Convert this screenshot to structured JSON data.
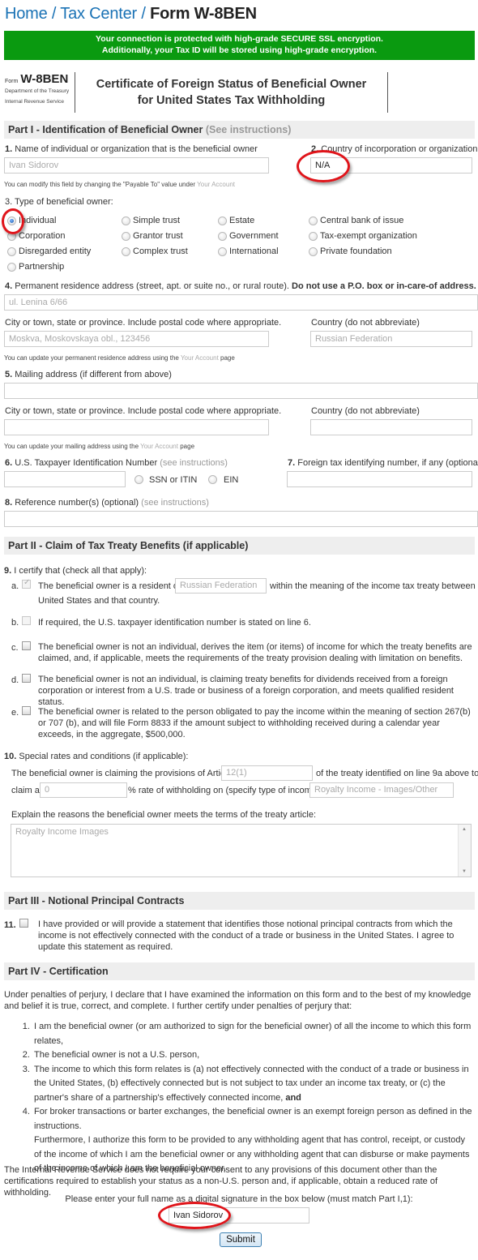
{
  "breadcrumb": {
    "home": "Home",
    "tax_center": "Tax Center",
    "current": "Form W-8BEN",
    "separator": "/"
  },
  "ssl_banner": {
    "line1": "Your connection is protected with high-grade SECURE SSL encryption.",
    "line2": "Additionally, your Tax ID will be stored using high-grade encryption.",
    "color": "#0a9a10"
  },
  "form_header": {
    "form_word": "Form",
    "form_name": "W-8BEN",
    "dept1": "Department of the Treasury",
    "dept2": "Internal Revenue Service",
    "title1": "Certificate of Foreign Status of Beneficial Owner",
    "title2": "for United States Tax Withholding"
  },
  "part1": {
    "title": "Part I - Identification of Beneficial Owner",
    "see": "(See instructions)",
    "q1_num": "1.",
    "q1_label": "Name of individual or organization that is the beneficial owner",
    "q1_value": "Ivan Sidorov",
    "q1_note_pre": "You can modify this field by changing the \"Payable To\" value under",
    "q1_note_link": "Your Account",
    "q2_num": "2.",
    "q2_label": "Country of incorporation or organization",
    "q2_value": "N/A",
    "q3_num": "3.",
    "q3_label": "Type of beneficial owner:",
    "owner_types": [
      {
        "label": "Individual",
        "checked": true
      },
      {
        "label": "Simple trust",
        "checked": false
      },
      {
        "label": "Estate",
        "checked": false
      },
      {
        "label": "Central bank of issue",
        "checked": false
      },
      {
        "label": "Corporation",
        "checked": false
      },
      {
        "label": "Grantor trust",
        "checked": false
      },
      {
        "label": "Government",
        "checked": false
      },
      {
        "label": "Tax-exempt organization",
        "checked": false
      },
      {
        "label": "Disregarded entity",
        "checked": false
      },
      {
        "label": "Complex trust",
        "checked": false
      },
      {
        "label": "International",
        "checked": false
      },
      {
        "label": "Private foundation",
        "checked": false
      },
      {
        "label": "Partnership",
        "checked": false
      }
    ],
    "q4_num": "4.",
    "q4_label": "Permanent residence address (street, apt. or suite no., or rural route).",
    "q4_bold": "Do not use a P.O. box or in-care-of address.",
    "q4_value": "ul. Lenina 6/66",
    "city_label": "City or town, state or province. Include postal code where appropriate.",
    "city_value": "Moskva, Moskovskaya obl., 123456",
    "country_label": "Country (do not abbreviate)",
    "country_value": "Russian Federation",
    "q4_note_pre": "You can update your permanent residence address using the",
    "q4_note_link": "Your Account",
    "q4_note_post": "page",
    "q5_num": "5.",
    "q5_label": "Mailing address (if different from above)",
    "q5_value": "",
    "mail_city_label": "City or town, state or province. Include postal code where appropriate.",
    "mail_city_value": "",
    "mail_country_label": "Country (do not abbreviate)",
    "mail_country_value": "",
    "q5_note_pre": "You can update your mailing address using the",
    "q5_note_link": "Your Account",
    "q5_note_post": "page",
    "q6_num": "6.",
    "q6_label": "U.S. Taxpayer Identification Number",
    "q6_see": "(see instructions)",
    "q6_value": "",
    "tin_types": [
      {
        "label": "SSN or ITIN",
        "checked": false
      },
      {
        "label": "EIN",
        "checked": false
      }
    ],
    "q7_num": "7.",
    "q7_label": "Foreign tax identifying number, if any (optional)",
    "q7_value": "",
    "q8_num": "8.",
    "q8_label": "Reference number(s) (optional)",
    "q8_see": "(see instructions)",
    "q8_value": ""
  },
  "part2": {
    "title": "Part II - Claim of Tax Treaty Benefits (if applicable)",
    "q9_num": "9.",
    "q9_label": "I certify that (check all that apply):",
    "items": [
      {
        "letter": "a.",
        "checked": true,
        "disabled": true,
        "text_pre": "The beneficial owner is a resident of",
        "input": "Russian Federation",
        "text_post": "within the meaning of the income tax treaty between the",
        "text_line2": "United States and that country."
      },
      {
        "letter": "b.",
        "checked": false,
        "disabled": true,
        "text": "If required, the U.S. taxpayer identification number is stated on line 6."
      },
      {
        "letter": "c.",
        "checked": false,
        "disabled": false,
        "text": "The beneficial owner is not an individual, derives the item (or items) of income for which the treaty benefits are claimed, and, if applicable, meets the requirements of the treaty provision dealing with limitation on benefits."
      },
      {
        "letter": "d.",
        "checked": false,
        "disabled": false,
        "text": "The beneficial owner is not an individual, is claiming treaty benefits for dividends received from a foreign corporation or interest from a U.S. trade or business of a foreign corporation, and meets qualified resident status."
      },
      {
        "letter": "e.",
        "checked": false,
        "disabled": false,
        "text": "The beneficial owner is related to the person obligated to pay the income within the meaning of section 267(b) or 707 (b), and will file Form 8833 if the amount subject to withholding received during a calendar year exceeds, in the aggregate, $500,000."
      }
    ],
    "q10_num": "10.",
    "q10_label": "Special rates and conditions (if applicable):",
    "q10_text1": "The beneficial owner is claiming the provisions of Article",
    "article_value": "12(1)",
    "q10_text2": "of the treaty identified on line 9a above to",
    "q10_text3": "claim a",
    "rate_value": "0",
    "q10_text4": "% rate of withholding on (specify type of income):",
    "income_type_value": "Royalty Income - Images/Other",
    "explain_label": "Explain the reasons the beneficial owner meets the terms of the treaty article:",
    "explain_value": "Royalty Income Images"
  },
  "part3": {
    "title": "Part III - Notional Principal Contracts",
    "q11_num": "11.",
    "q11_checked": false,
    "q11_text": "I have provided or will provide a statement that identifies those notional principal contracts from which the income is not effectively connected with the conduct of a trade or business in the United States. I agree to update this statement as required."
  },
  "part4": {
    "title": "Part IV - Certification",
    "intro": "Under penalties of perjury, I declare that I have examined the information on this form and to the best of my knowledge and belief it is true, correct, and complete. I further certify under penalties of perjury that:",
    "items": [
      "I am the beneficial owner (or am authorized to sign for the beneficial owner) of all the income to which this form relates,",
      "The beneficial owner is not a U.S. person,",
      "The income to which this form relates is (a) not effectively connected with the conduct of a trade or business in the United States, (b) effectively connected but is not subject to tax under an income tax treaty, or (c) the partner's share of a partnership's effectively connected income,",
      "For broker transactions or barter exchanges, the beneficial owner is an exempt foreign person as defined in the instructions."
    ],
    "item3_bold": "and",
    "furthermore": "Furthermore, I authorize this form to be provided to any withholding agent that has control, receipt, or custody of the income of which I am the beneficial owner or any withholding agent that can disburse or make payments of the income of which I am the beneficial owner.",
    "irs_note": "The Internal Revenue Service does not require your consent to any provisions of this document other than the certifications required to establish your status as a non-U.S. person and, if applicable, obtain a reduced rate of withholding.",
    "signature_label": "Please enter your full name as a digital signature in the box below (must match Part I,1):",
    "signature_value": "Ivan Sidorov",
    "submit_label": "Submit"
  },
  "annotations": {
    "highlight_color": "#e0141a"
  }
}
